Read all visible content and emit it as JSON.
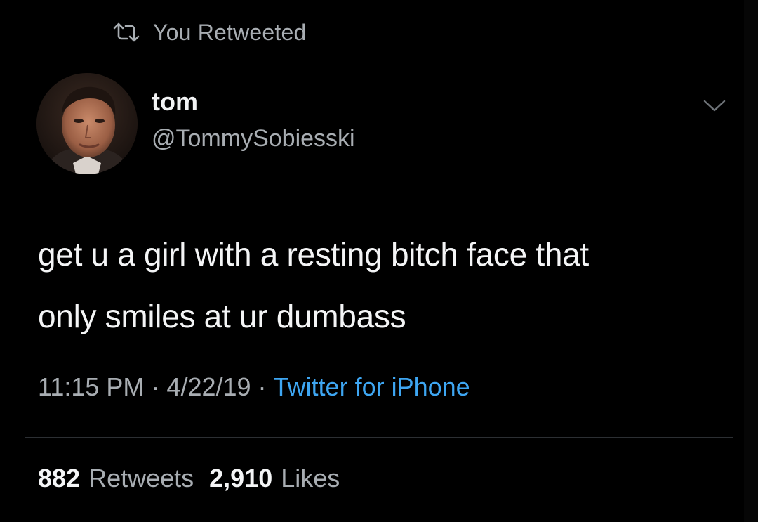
{
  "retweet_banner": {
    "icon": "retweet-icon",
    "text": "You Retweeted"
  },
  "author": {
    "avatar": "profile-photo",
    "display_name": "tom",
    "handle": "@TommySobiesski"
  },
  "menu": {
    "icon": "chevron-down-icon"
  },
  "tweet": {
    "lines": [
      "get u a girl with a resting bitch face that",
      "only smiles at ur dumbass"
    ]
  },
  "meta": {
    "time": "11:15 PM",
    "separator": "·",
    "date": "4/22/19",
    "source": "Twitter for iPhone"
  },
  "stats": {
    "retweets_count": "882",
    "retweets_label": "Retweets",
    "likes_count": "2,910",
    "likes_label": "Likes"
  },
  "colors": {
    "background": "#000000",
    "text_primary": "#f4f5f6",
    "text_secondary": "#a8adb2",
    "link": "#3ea6f2",
    "divider": "#2c2f33"
  }
}
